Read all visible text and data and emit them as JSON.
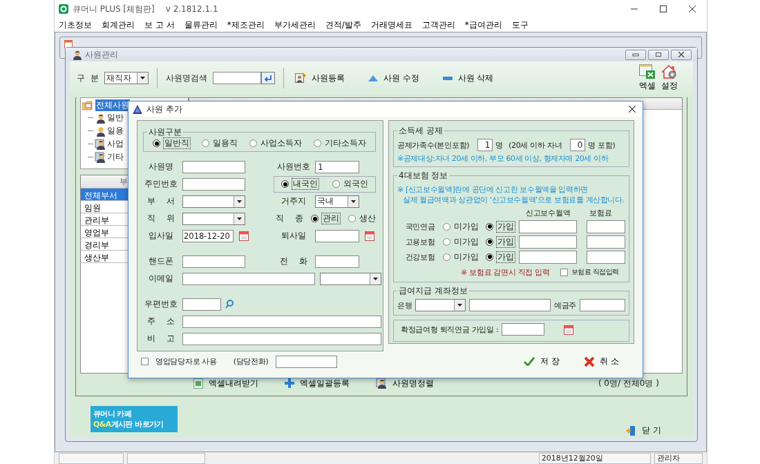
{
  "app": {
    "title": "큐머니 PLUS [체험판]",
    "version": "v 2.1812.1.1"
  },
  "menu": [
    "기초정보",
    "회계관리",
    "보 고 서",
    "물류관리",
    "*제조관리",
    "부가세관리",
    "견적/발주",
    "거래명세표",
    "고객관리",
    "*급여관리",
    "도구"
  ],
  "employee_window": {
    "title": "사원관리",
    "toolbar": {
      "category_label": "구 분",
      "category_value": "재직자",
      "search_label": "사원명검색",
      "actions": [
        {
          "kind": "add",
          "label": "사원등록"
        },
        {
          "kind": "edit",
          "label": "사원 수정"
        },
        {
          "kind": "delete",
          "label": "사원 삭제"
        }
      ],
      "tools": [
        {
          "kind": "excel",
          "label": "엑셀"
        },
        {
          "kind": "settings",
          "label": "설정"
        }
      ]
    },
    "tree": {
      "label": "전체사원",
      "selected": true,
      "children": [
        {
          "kind": "regular",
          "label": "일반"
        },
        {
          "kind": "daily",
          "label": "일용"
        },
        {
          "kind": "business",
          "label": "사업"
        },
        {
          "kind": "other",
          "label": "기타"
        }
      ]
    },
    "departments": {
      "header": "부",
      "items": [
        {
          "label": "전체부서",
          "selected": true
        },
        {
          "label": "임원",
          "selected": false
        },
        {
          "label": "관리부",
          "selected": false
        },
        {
          "label": "영업부",
          "selected": false
        },
        {
          "label": "경리부",
          "selected": false
        },
        {
          "label": "생산부",
          "selected": false
        }
      ]
    },
    "bottom_actions": [
      {
        "kind": "download",
        "label": "엑셀내려받기"
      },
      {
        "kind": "upload",
        "label": "엑셀일괄등록"
      },
      {
        "kind": "sort",
        "label": "사원명정렬"
      }
    ],
    "count": "( 0명/ 전체0명 )",
    "banner": {
      "line1": "큐머니 카페",
      "highlight": "Q&A",
      "line2": "게시판 바로가기"
    },
    "close": "닫 기"
  },
  "dialog": {
    "title": "사원 추가",
    "category": {
      "legend": "사원구분",
      "options": [
        {
          "label": "일반직",
          "selected": true
        },
        {
          "label": "일용직",
          "selected": false
        },
        {
          "label": "사업소득자",
          "selected": false
        },
        {
          "label": "기타소득자",
          "selected": false
        }
      ]
    },
    "groups": [
      [
        [
          {
            "label": "사원명",
            "kind": "text"
          },
          {
            "label": "사원번호",
            "kind": "text",
            "value": "1"
          }
        ],
        [
          {
            "label": "주민번호",
            "kind": "text"
          },
          {
            "kind": "radios",
            "options": [
              {
                "label": "내국인",
                "selected": true
              },
              {
                "label": "외국인",
                "selected": false
              }
            ]
          }
        ],
        [
          {
            "label": "부 서",
            "kind": "select"
          },
          {
            "label": "거주지",
            "kind": "select",
            "value": "국내"
          }
        ],
        [
          {
            "label": "직 위",
            "kind": "select"
          },
          {
            "label": "직 종",
            "kind": "inline-radios",
            "options": [
              {
                "label": "관리",
                "selected": true
              },
              {
                "label": "생산",
                "selected": false
              }
            ]
          }
        ],
        [
          {
            "label": "입사일",
            "kind": "date",
            "value": "2018-12-20"
          },
          {
            "label": "퇴사일",
            "kind": "date"
          }
        ]
      ],
      [
        [
          {
            "label": "핸드폰",
            "kind": "text"
          },
          {
            "label": "전 화",
            "kind": "text"
          }
        ],
        [
          {
            "label": "이메일",
            "kind": "email"
          }
        ]
      ],
      [
        [
          {
            "label": "우편번호",
            "kind": "zip"
          }
        ],
        [
          {
            "label": "주 소",
            "kind": "line"
          }
        ],
        [
          {
            "label": "비 고",
            "kind": "line"
          }
        ]
      ]
    ],
    "sales_rep": {
      "label": "영업담당자로 사용",
      "checked": false,
      "phone_label": "(담당전화)"
    },
    "tax": {
      "legend": "소득세 공제",
      "family_label": "공제가족수(본인포함)",
      "family_value": "1",
      "unit": "명",
      "children_label": "(20세 이하 자녀",
      "children_value": "0",
      "children_unit": "명 포함)",
      "note": "※공제대상:자녀 20세 이하, 부모 60세 이상, 형제자매 20세 이하"
    },
    "insurance": {
      "legend": "4대보험 정보",
      "notes": [
        "※ [신고보수월액]란에 공단에 신고한 보수월액을 입력하면",
        "실제 월급여액과 상관없이 '신고보수월액'으로 보험료를 계산합니다."
      ],
      "columns": [
        "신고보수월액",
        "보험료"
      ],
      "rows": [
        {
          "label": "국민연금",
          "options": [
            {
              "label": "미가입",
              "selected": false
            },
            {
              "label": "가입",
              "selected": true
            }
          ]
        },
        {
          "label": "고용보험",
          "options": [
            {
              "label": "미가입",
              "selected": false
            },
            {
              "label": "가입",
              "selected": true
            }
          ]
        },
        {
          "label": "건강보험",
          "options": [
            {
              "label": "미가입",
              "selected": false
            },
            {
              "label": "가입",
              "selected": true
            }
          ]
        }
      ],
      "warning": "※ 보험료 감면시 직접 입력",
      "manual": {
        "label": "보험료 직접입력",
        "checked": false
      }
    },
    "account": {
      "legend": "급여지급 계좌정보",
      "bank_label": "은행",
      "holder_label": "예금주"
    },
    "pension": {
      "label": "확정급여형 퇴직연금 가입일 :"
    },
    "buttons": [
      {
        "kind": "save",
        "label": "저 장"
      },
      {
        "kind": "cancel",
        "label": "취 소"
      }
    ]
  },
  "status_bar": [
    {
      "kind": "blank"
    },
    {
      "kind": "blank"
    },
    {
      "kind": "text",
      "text": "2018년12월20일"
    },
    {
      "kind": "text",
      "text": "관리자"
    }
  ]
}
